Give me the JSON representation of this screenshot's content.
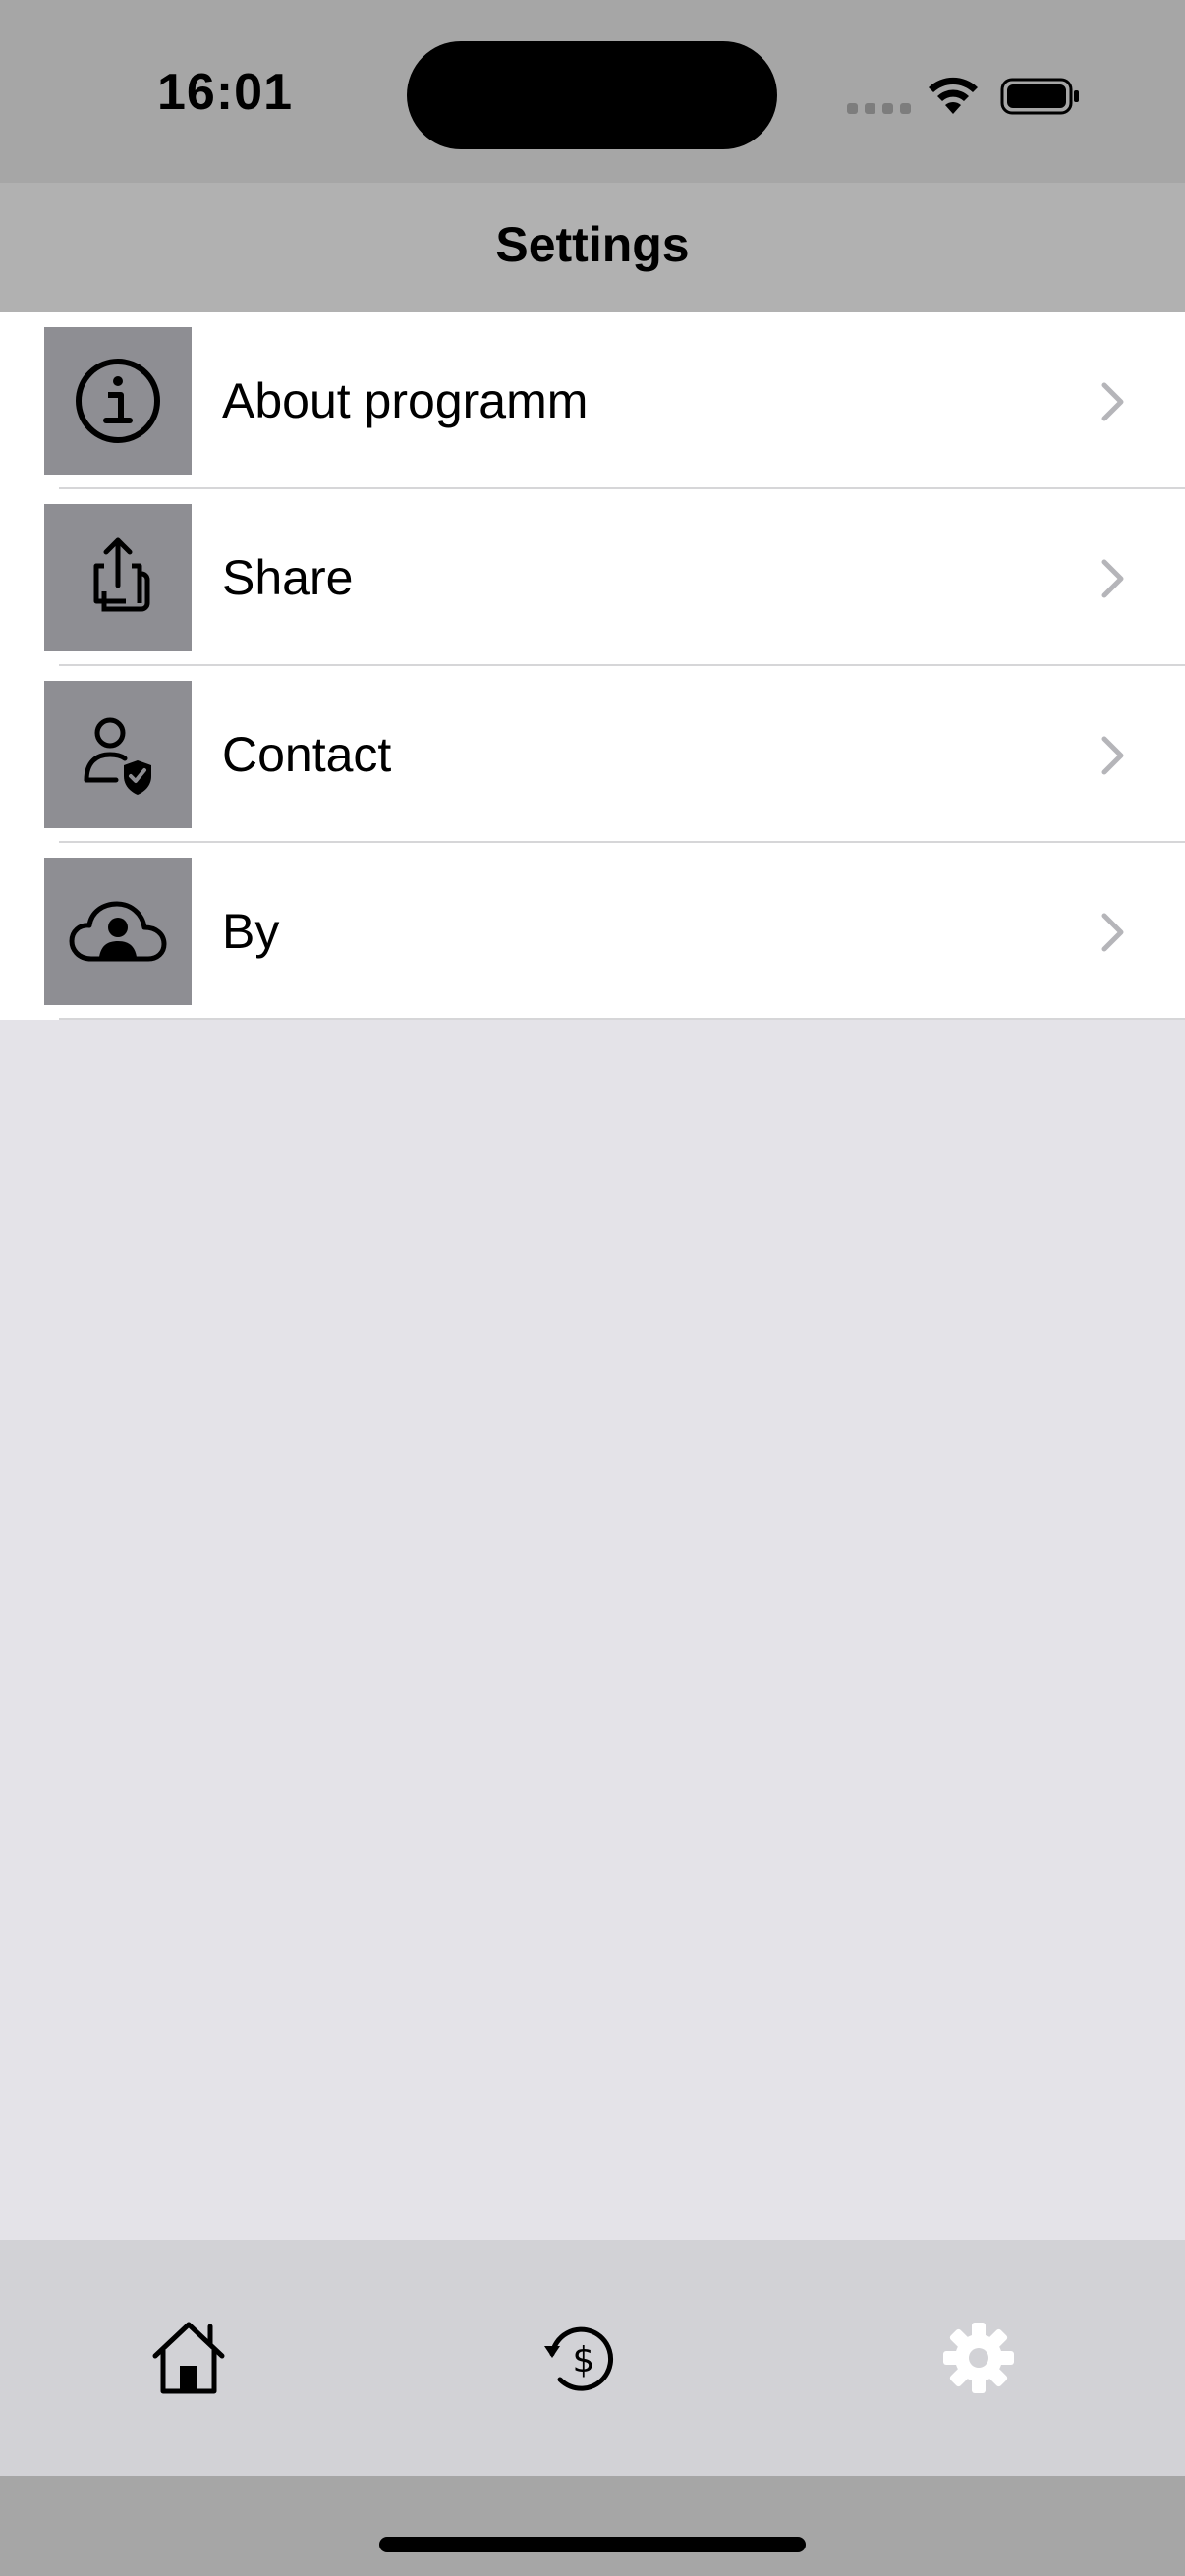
{
  "status_bar": {
    "time": "16:01"
  },
  "nav": {
    "title": "Settings"
  },
  "settings": {
    "items": [
      {
        "label": "About programm",
        "icon": "info-circle-icon"
      },
      {
        "label": "Share",
        "icon": "share-icon"
      },
      {
        "label": "Contact",
        "icon": "person-shield-icon"
      },
      {
        "label": "By",
        "icon": "cloud-person-icon"
      }
    ]
  },
  "tab_bar": {
    "tabs": [
      {
        "icon": "home-icon",
        "selected": false
      },
      {
        "icon": "currency-history-icon",
        "selected": false
      },
      {
        "icon": "gear-icon",
        "selected": true
      }
    ]
  },
  "colors": {
    "status_bar_bg": "#a6a6a6",
    "nav_bar_bg": "#b1b1b1",
    "icon_tile_bg": "#8e8e93",
    "page_bg": "#e4e3e8",
    "tab_bar_bg": "#d2d2d6",
    "selected_tab": "#ffffff"
  }
}
